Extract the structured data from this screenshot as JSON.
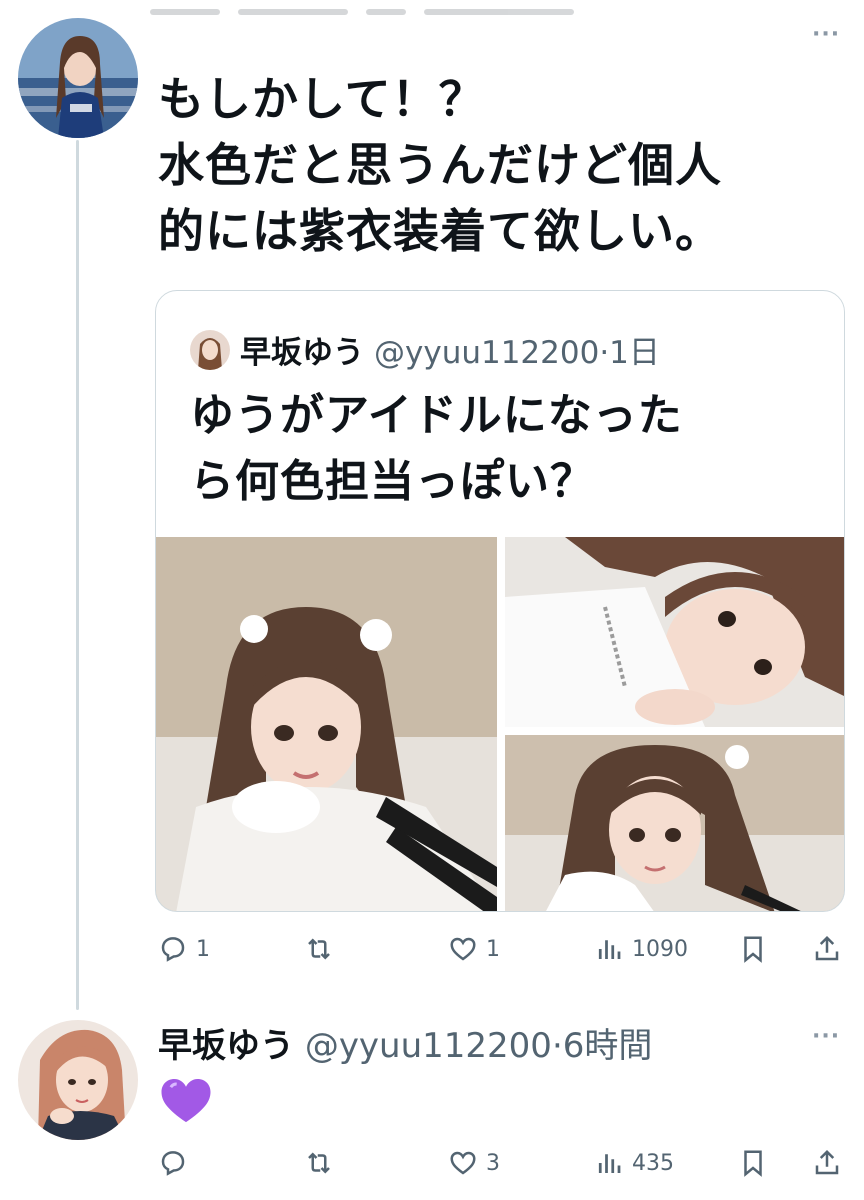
{
  "post1": {
    "text_lines": [
      "もしかして！？",
      "水色だと思うんだけど個人",
      "的には紫衣装着て欲しい。"
    ],
    "actions": {
      "reply": "1",
      "retweet": "",
      "like": "1",
      "views": "1090"
    }
  },
  "quote": {
    "name": "早坂ゆう",
    "handle_time": "@yyuu112200·1日",
    "text_lines": [
      "ゆうがアイドルになった",
      "ら何色担当っぽい？"
    ]
  },
  "post2": {
    "name": "早坂ゆう",
    "handle_time": "@yyuu112200·6時間",
    "emoji": "purple-heart",
    "actions": {
      "reply": "",
      "retweet": "",
      "like": "3",
      "views": "435"
    }
  },
  "icons": [
    "more-icon",
    "reply-icon",
    "retweet-icon",
    "like-icon",
    "views-icon",
    "bookmark-icon",
    "share-icon"
  ],
  "colors": {
    "text": "#0f1419",
    "secondary": "#536471",
    "border": "#cfd9de",
    "heart": "#a259e6"
  }
}
